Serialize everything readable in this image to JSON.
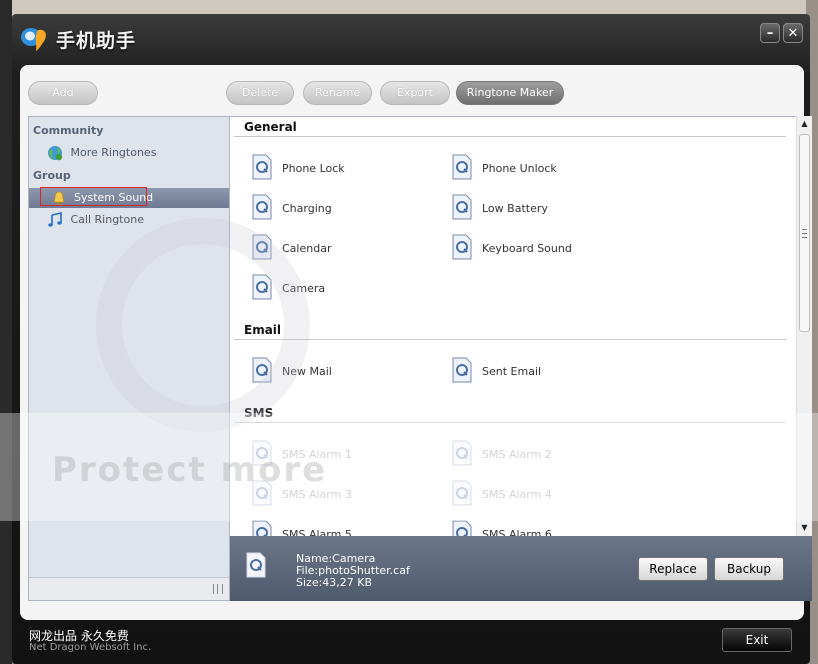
{
  "window": {
    "title": "手机助手",
    "minimize_label": "–",
    "close_label": "✕"
  },
  "toolbar": {
    "add": "Add",
    "delete": "Delete",
    "rename": "Rename",
    "export": "Export",
    "ringtone_maker": "Ringtone Maker"
  },
  "sidebar": {
    "community_label": "Community",
    "more_ringtones": "More Ringtones",
    "group_label": "Group",
    "system_sound": "System Sound",
    "call_ringtone": "Call Ringtone"
  },
  "sections": {
    "general": {
      "title": "General",
      "items": [
        "Phone Lock",
        "Phone Unlock",
        "Charging",
        "Low Battery",
        "Calendar",
        "Keyboard Sound",
        "Camera"
      ]
    },
    "email": {
      "title": "Email",
      "items": [
        "New Mail",
        "Sent Email"
      ]
    },
    "sms": {
      "title": "SMS",
      "items": [
        "SMS Alarm 1",
        "SMS Alarm 2",
        "SMS Alarm 3",
        "SMS Alarm 4",
        "SMS Alarm 5",
        "SMS Alarm 6"
      ]
    }
  },
  "details": {
    "name": "Name:Camera",
    "file": "File:photoShutter.caf",
    "size": "Size:43,27 KB",
    "replace": "Replace",
    "backup": "Backup"
  },
  "footer": {
    "cn": "网龙出品 永久免费",
    "en": "Net Dragon Websoft Inc.",
    "exit": "Exit"
  },
  "watermark": "Protect more",
  "colors": {
    "accent": "#6f7a93",
    "selection_outline": "#dd2222",
    "title_bg": "#1e1e1e"
  }
}
